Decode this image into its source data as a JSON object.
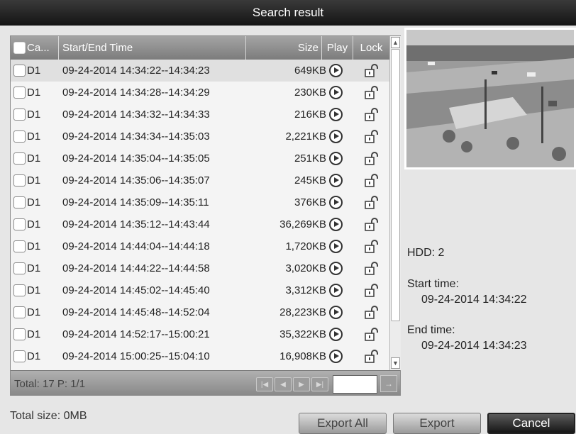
{
  "window": {
    "title": "Search result"
  },
  "table": {
    "headers": {
      "camera": "Ca...",
      "time": "Start/End Time",
      "size": "Size",
      "play": "Play",
      "lock": "Lock"
    },
    "rows": [
      {
        "camera": "D1",
        "time": "09-24-2014 14:34:22--14:34:23",
        "size": "649KB"
      },
      {
        "camera": "D1",
        "time": "09-24-2014 14:34:28--14:34:29",
        "size": "230KB"
      },
      {
        "camera": "D1",
        "time": "09-24-2014 14:34:32--14:34:33",
        "size": "216KB"
      },
      {
        "camera": "D1",
        "time": "09-24-2014 14:34:34--14:35:03",
        "size": "2,221KB"
      },
      {
        "camera": "D1",
        "time": "09-24-2014 14:35:04--14:35:05",
        "size": "251KB"
      },
      {
        "camera": "D1",
        "time": "09-24-2014 14:35:06--14:35:07",
        "size": "245KB"
      },
      {
        "camera": "D1",
        "time": "09-24-2014 14:35:09--14:35:11",
        "size": "376KB"
      },
      {
        "camera": "D1",
        "time": "09-24-2014 14:35:12--14:43:44",
        "size": "36,269KB"
      },
      {
        "camera": "D1",
        "time": "09-24-2014 14:44:04--14:44:18",
        "size": "1,720KB"
      },
      {
        "camera": "D1",
        "time": "09-24-2014 14:44:22--14:44:58",
        "size": "3,020KB"
      },
      {
        "camera": "D1",
        "time": "09-24-2014 14:45:02--14:45:40",
        "size": "3,312KB"
      },
      {
        "camera": "D1",
        "time": "09-24-2014 14:45:48--14:52:04",
        "size": "28,223KB"
      },
      {
        "camera": "D1",
        "time": "09-24-2014 14:52:17--15:00:21",
        "size": "35,322KB"
      },
      {
        "camera": "D1",
        "time": "09-24-2014 15:00:25--15:04:10",
        "size": "16,908KB"
      }
    ],
    "play_icon": "play-circle-icon",
    "lock_icon": "unlock-icon",
    "selected_row": 0
  },
  "pager": {
    "total_text": "Total: 17  P: 1/1",
    "buttons": [
      "first-page-icon",
      "prev-page-icon",
      "next-page-icon",
      "last-page-icon"
    ],
    "page_input": "",
    "go_icon": "arrow-right-icon"
  },
  "details": {
    "hdd": "HDD: 2",
    "start_label": "Start time:",
    "start_value": "09-24-2014 14:34:22",
    "end_label": "End time:",
    "end_value": "09-24-2014 14:34:23"
  },
  "footer": {
    "total_size": "Total size: 0MB",
    "export_all": "Export All",
    "export": "Export",
    "cancel": "Cancel"
  },
  "colors": {
    "titlebar": "#141414",
    "panel": "#f4f4f4",
    "header": "#8c8c8c",
    "selected_row": "#e0e0e0"
  }
}
